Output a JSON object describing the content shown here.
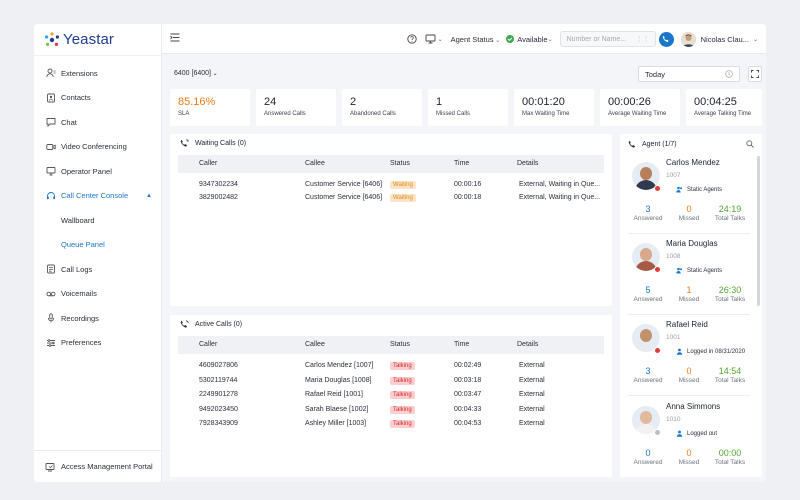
{
  "brand": {
    "name": "Yeastar"
  },
  "sidebar": {
    "items": [
      {
        "label": "Extensions",
        "icon": "extensions-icon"
      },
      {
        "label": "Contacts",
        "icon": "contacts-icon"
      },
      {
        "label": "Chat",
        "icon": "chat-icon"
      },
      {
        "label": "Video Conferencing",
        "icon": "video-icon"
      },
      {
        "label": "Operator Panel",
        "icon": "monitor-icon"
      },
      {
        "label": "Call Center Console",
        "icon": "headset-icon"
      },
      {
        "label": "Wallboard"
      },
      {
        "label": "Queue Panel"
      },
      {
        "label": "Call Logs",
        "icon": "call-logs-icon"
      },
      {
        "label": "Voicemails",
        "icon": "voicemail-icon"
      },
      {
        "label": "Recordings",
        "icon": "microphone-icon"
      },
      {
        "label": "Preferences",
        "icon": "preferences-icon"
      }
    ],
    "portal": "Access Management Portal"
  },
  "topbar": {
    "agent_status": "Agent Status",
    "available": "Available",
    "search_placeholder": "Number or Name...",
    "user_name": "Nicolas Clau..."
  },
  "queue": "6400 [6400]",
  "date_filter": "Today",
  "stats": [
    {
      "value": "85.16%",
      "label": "SLA"
    },
    {
      "value": "24",
      "label": "Answered Calls"
    },
    {
      "value": "2",
      "label": "Abandoned Calls"
    },
    {
      "value": "1",
      "label": "Missed Calls"
    },
    {
      "value": "00:01:20",
      "label": "Max Waiting Time"
    },
    {
      "value": "00:00:26",
      "label": "Average Waiting Time"
    },
    {
      "value": "00:04:25",
      "label": "Average Talking Time"
    }
  ],
  "waiting": {
    "title": "Waiting Calls (0)",
    "columns": [
      "Caller",
      "Callee",
      "Status",
      "Time",
      "Details"
    ],
    "rows": [
      {
        "caller": "9347302234",
        "callee": "Customer Service [6406]",
        "status": "Waiting",
        "time": "00:00:16",
        "details": "External, Waiting in Que..."
      },
      {
        "caller": "3829002482",
        "callee": "Customer Service [6406]",
        "status": "Waiting",
        "time": "00:00:18",
        "details": "External, Waiting in Que..."
      }
    ]
  },
  "active": {
    "title": "Active Calls (0)",
    "columns": [
      "Caller",
      "Callee",
      "Status",
      "Time",
      "Details"
    ],
    "rows": [
      {
        "caller": "4609027806",
        "callee": "Carlos Mendez [1007]",
        "status": "Talking",
        "time": "00:02:49",
        "details": "External"
      },
      {
        "caller": "5302119744",
        "callee": "Maria Douglas [1008]",
        "status": "Talking",
        "time": "00:03:18",
        "details": "External"
      },
      {
        "caller": "2249901278",
        "callee": "Rafael Reid [1001]",
        "status": "Talking",
        "time": "00:03:47",
        "details": "External"
      },
      {
        "caller": "9492023450",
        "callee": "Sarah Blaese [1002]",
        "status": "Talking",
        "time": "00:04:33",
        "details": "External"
      },
      {
        "caller": "7928343909",
        "callee": "Ashley Miller [1003]",
        "status": "Talking",
        "time": "00:04:53",
        "details": "External"
      }
    ]
  },
  "agents": {
    "title": "Agent (1/7)",
    "labels": {
      "answered": "Answered",
      "missed": "Missed",
      "total": "Total Talks"
    },
    "list": [
      {
        "name": "Carlos Mendez",
        "ext": "1007",
        "group": "Static Agents",
        "answered": "3",
        "missed": "0",
        "total": "24:19"
      },
      {
        "name": "Maria Douglas",
        "ext": "1008",
        "group": "Static Agents",
        "answered": "5",
        "missed": "1",
        "total": "26:30"
      },
      {
        "name": "Rafael Reid",
        "ext": "1001",
        "group": "Logged in 08/31/2020",
        "answered": "3",
        "missed": "0",
        "total": "14:54"
      },
      {
        "name": "Anna Simmons",
        "ext": "1010",
        "group": "Logged out",
        "answered": "0",
        "missed": "0",
        "total": "00:00"
      }
    ]
  },
  "colors": {
    "accent": "#1a76c9",
    "sla": "#f07c1a",
    "answered": "#1a76c9",
    "missed": "#f07c1a",
    "total": "#52a832",
    "talking": "#d7262b",
    "waiting": "#e88a1a"
  }
}
